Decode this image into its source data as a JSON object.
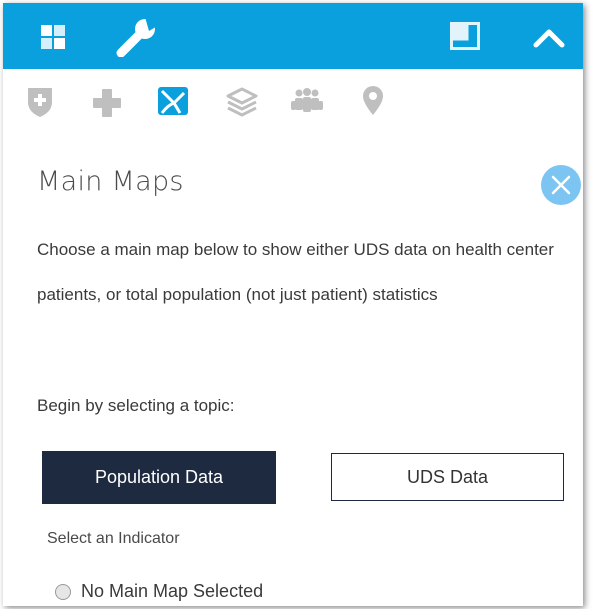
{
  "panel": {
    "title": "Main Maps",
    "description": "Choose a main map below to show either UDS data on health center patients, or total population (not just patient) statistics",
    "topic_prompt": "Begin by selecting a topic:",
    "buttons": {
      "population": "Population Data",
      "uds": "UDS Data"
    },
    "indicator_label": "Select an Indicator",
    "radio_option": "No Main Map Selected"
  },
  "toolbar": {
    "icons": [
      "grid-icon",
      "wrench-icon",
      "window-icon",
      "chevron-up-icon"
    ]
  },
  "tabs": {
    "icons": [
      "shield-plus-icon",
      "medical-cross-icon",
      "main-map-icon",
      "layers-icon",
      "people-icon",
      "map-pin-icon"
    ]
  },
  "colors": {
    "topbar": "#0aa0de",
    "active_tab": "#0aa0de",
    "inactive_tab": "#bfbfbf",
    "primary_button": "#1e2a3f",
    "close_button": "#7cc4f2"
  }
}
